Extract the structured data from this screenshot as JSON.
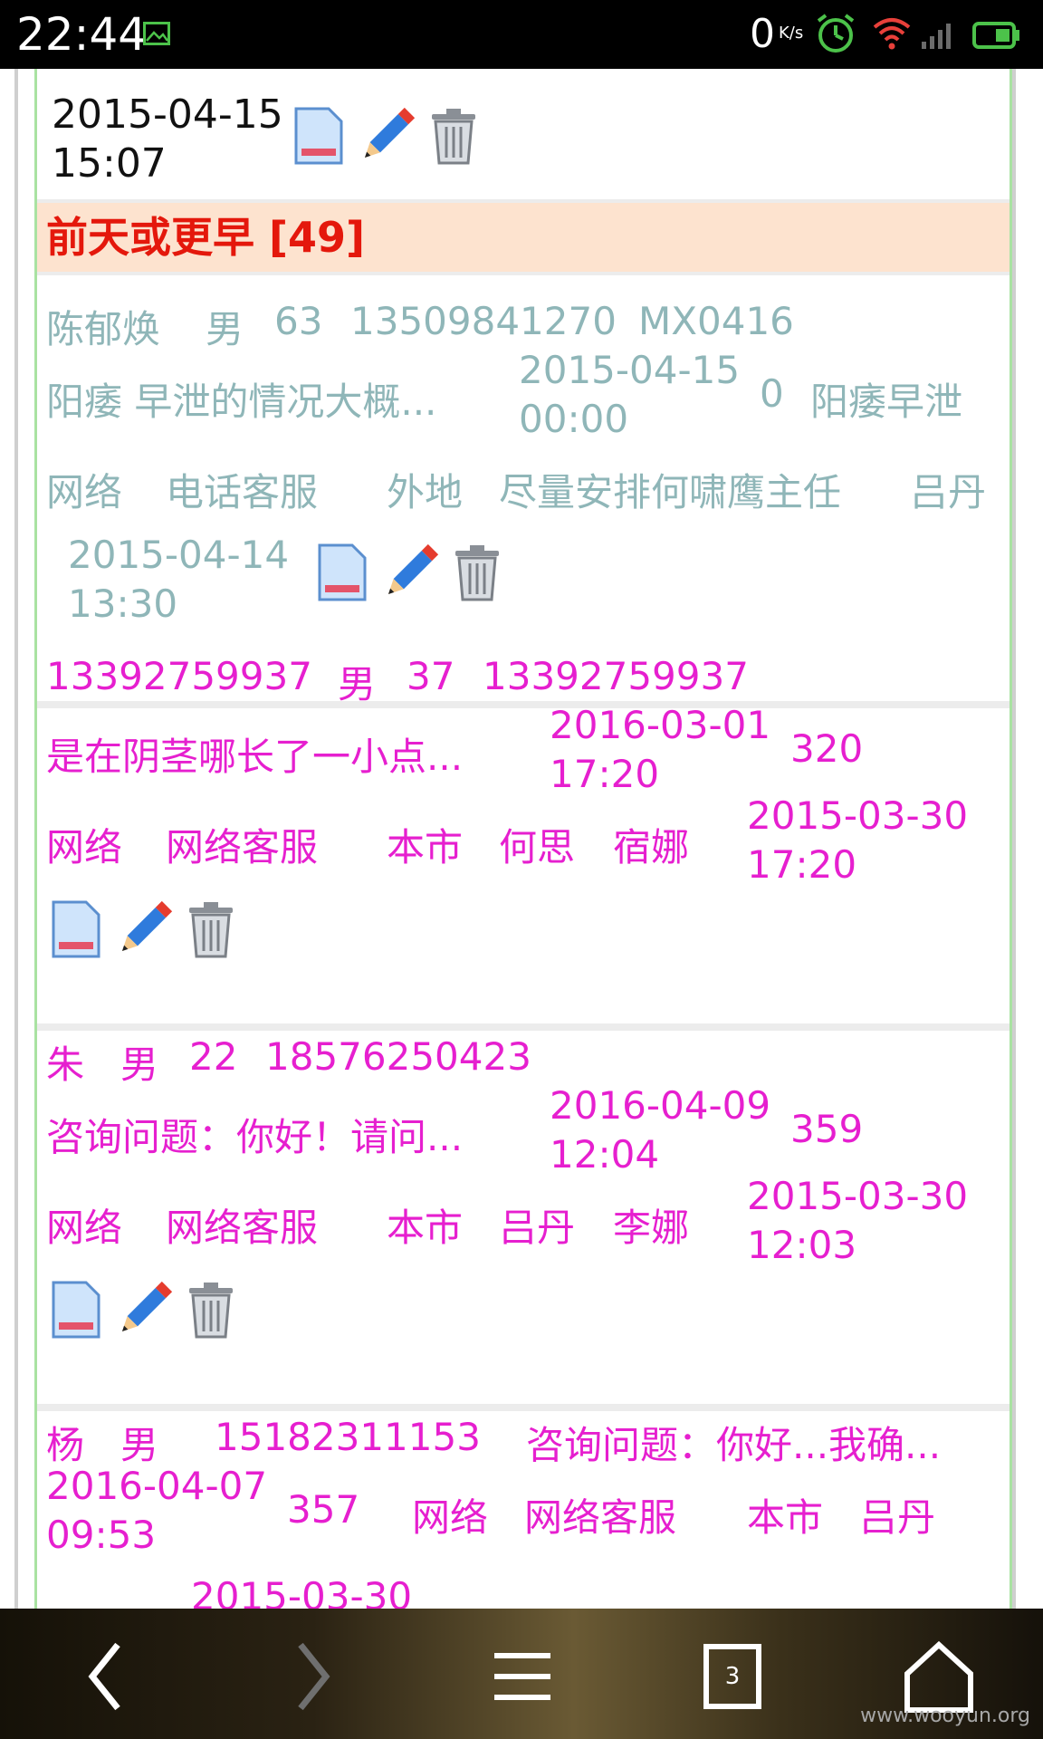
{
  "status_bar": {
    "time": "22:44",
    "net_speed": "0",
    "net_unit": "K/s",
    "icons": [
      "image-icon",
      "alarm-icon",
      "wifi-icon",
      "signal-icon",
      "battery-icon"
    ]
  },
  "first_record": {
    "cut_text": "",
    "datetime_line1": "2015-04-15",
    "datetime_line2": "15:07"
  },
  "section": {
    "title": "前天或更早 [49]"
  },
  "records": [
    {
      "name": "陈郁焕",
      "gender": "男",
      "age": "63",
      "phone": "13509841270",
      "code": "MX0416",
      "question": "阳痿 早泄的情况大概...",
      "date1a": "2015-04-15",
      "date1b": "00:00",
      "count": "0",
      "disease": "阳痿早泄",
      "source": "网络",
      "channel": "电话客服",
      "area": "外地",
      "note": "尽量安排何啸鹰主任",
      "staff": "吕丹",
      "date2a": "2015-04-14",
      "date2b": "13:30"
    },
    {
      "name": "13392759937",
      "gender": "男",
      "age": "37",
      "phone": "13392759937",
      "question": "是在阴茎哪长了一小点...",
      "date1a": "2016-03-01",
      "date1b": "17:20",
      "count": "320",
      "source": "网络",
      "channel": "网络客服",
      "area": "本市",
      "doctor": "何思",
      "staff": "宿娜",
      "date2a": "2015-03-30",
      "date2b": "17:20"
    },
    {
      "name": "朱",
      "gender": "男",
      "age": "22",
      "phone": "18576250423",
      "question": "咨询问题：你好！请问...",
      "date1a": "2016-04-09",
      "date1b": "12:04",
      "count": "359",
      "source": "网络",
      "channel": "网络客服",
      "area": "本市",
      "doctor": "吕丹",
      "staff": "李娜",
      "date2a": "2015-03-30",
      "date2b": "12:03"
    },
    {
      "name": "杨",
      "gender": "男",
      "phone": "15182311153",
      "question": "咨询问题：你好...我确...",
      "date1a": "2016-04-07",
      "date1b": "09:53",
      "count": "357",
      "source": "网络",
      "channel": "网络客服",
      "area": "本市",
      "staff": "吕丹",
      "date2_partial": "2015-03-30"
    }
  ],
  "nav": {
    "tab_count": "3"
  },
  "watermark": "www.wooyun.org"
}
